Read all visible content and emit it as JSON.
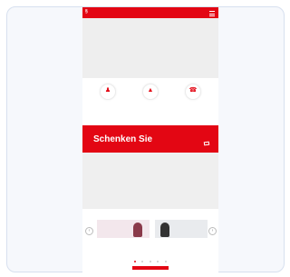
{
  "header": {
    "logo_text": "§ ",
    "menu_icon": "hamburger-icon",
    "brand_color": "#e30613"
  },
  "quicklinks": {
    "items": [
      {
        "icon": "person-icon",
        "glyph": "♟",
        "label": ""
      },
      {
        "icon": "warning-icon",
        "glyph": "▲",
        "label": ""
      },
      {
        "icon": "phone-icon",
        "glyph": "☎",
        "label": ""
      }
    ]
  },
  "promo": {
    "title_line1": "Schenken Sie",
    "title_line2": "",
    "badge": ""
  },
  "cards": {
    "items": [
      {
        "title": "",
        "text": "",
        "link": ""
      },
      {
        "title": "",
        "text": "",
        "link": ""
      }
    ]
  },
  "carousel": {
    "prev_label": "‹",
    "next_label": "›",
    "slide_count": 5,
    "active_index": 0
  }
}
